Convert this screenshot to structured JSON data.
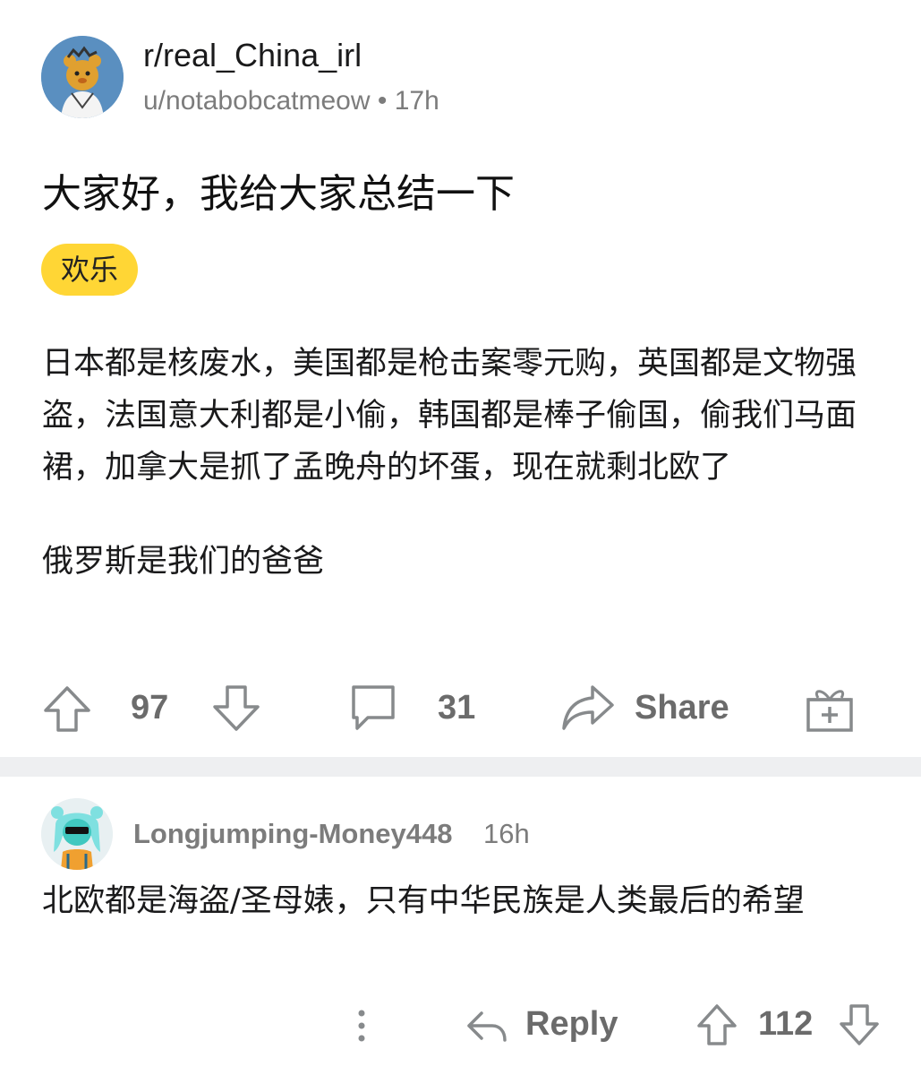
{
  "post": {
    "subreddit": "r/real_China_irl",
    "author": "u/notabobcatmeow",
    "separator": "•",
    "age": "17h",
    "title": "大家好，我给大家总结一下",
    "flair": "欢乐",
    "body": [
      "日本都是核废水，美国都是枪击案零元购，英国都是文物强盗，法国意大利都是小偷，韩国都是棒子偷国，偷我们马面裙，加拿大是抓了孟晚舟的坏蛋，现在就剩北欧了",
      "俄罗斯是我们的爸爸"
    ],
    "actions": {
      "score": "97",
      "comments": "31",
      "share_label": "Share",
      "icons": [
        "upvote-icon",
        "downvote-icon",
        "comment-icon",
        "share-icon",
        "award-icon"
      ]
    }
  },
  "comment": {
    "user": "Longjumping-Money448",
    "age": "16h",
    "body": "北欧都是海盗/圣母婊，只有中华民族是人类最后的希望",
    "reply_label": "Reply",
    "score": "112",
    "icons": [
      "more-options-icon",
      "reply-icon",
      "upvote-icon",
      "downvote-icon"
    ]
  },
  "colors": {
    "flair_bg": "#ffd635",
    "muted_text": "#7c7c7c",
    "divider": "#eeeff1",
    "avatar_bg": "#5a8fc0"
  }
}
